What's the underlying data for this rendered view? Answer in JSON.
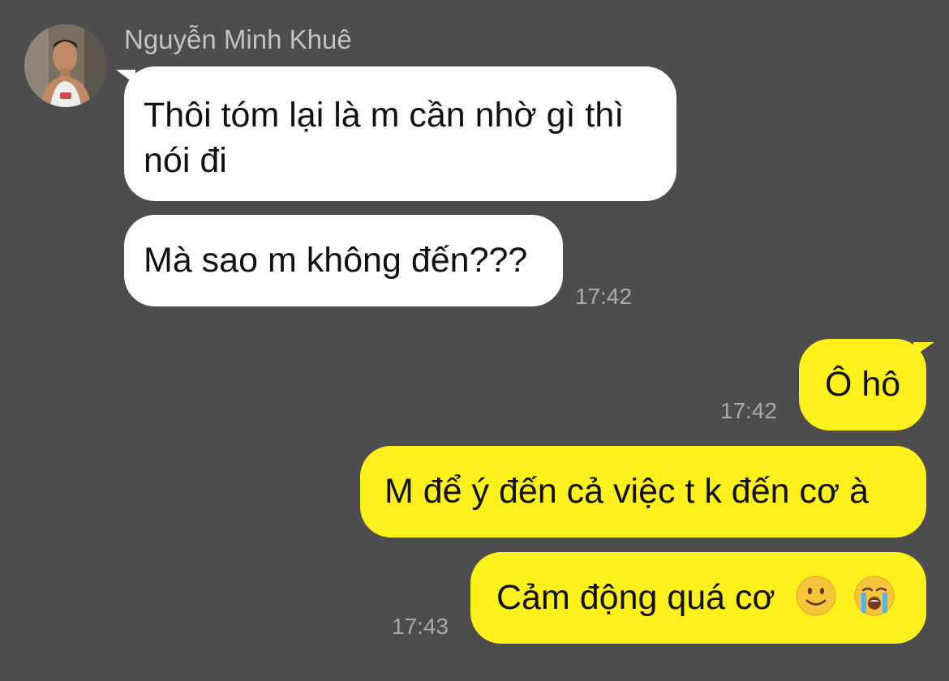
{
  "contact": {
    "name": "Nguyễn Minh Khuê",
    "avatar_icon": "contact-avatar-photo"
  },
  "messages": {
    "in_1": {
      "text_line1": "Thôi tóm lại là m cần nhờ gì thì",
      "text_line2": "nói đi"
    },
    "in_2": {
      "text": "Mà sao m không đến???"
    },
    "in_time": "17:42",
    "out_1": {
      "text": "Ô hô"
    },
    "out_1_time": "17:42",
    "out_2": {
      "text": "M để ý đến cả việc t k đến cơ à"
    },
    "out_3": {
      "text": "Cảm động quá cơ",
      "emojis": [
        "slightly-smiling-face-icon",
        "loudly-crying-face-icon"
      ]
    },
    "out_3_time": "17:43"
  },
  "colors": {
    "background": "#4d4c4e",
    "incoming_bubble": "#ffffff",
    "outgoing_bubble": "#fef01b",
    "timestamp": "#a9a9a9",
    "sender_name": "#c3c3c3"
  }
}
